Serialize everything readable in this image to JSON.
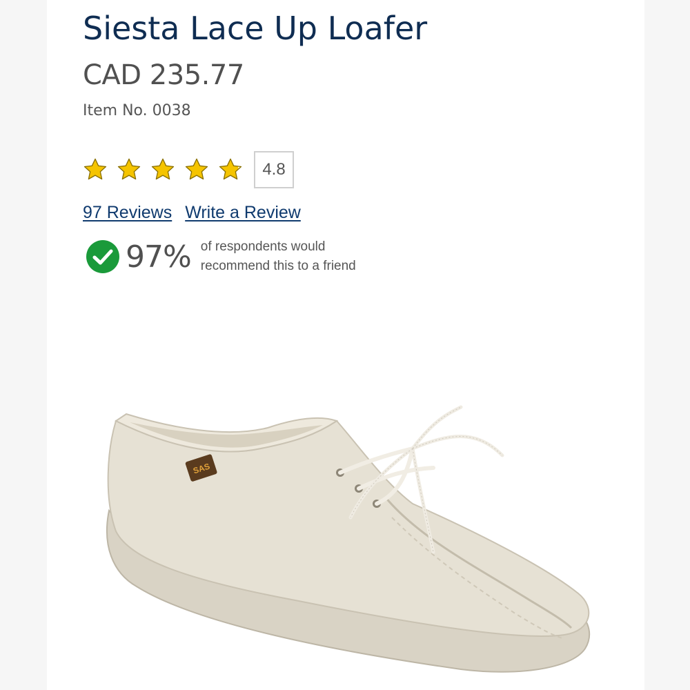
{
  "product": {
    "title": "Siesta Lace Up Loafer",
    "price": "CAD 235.77",
    "item_number": "Item No. 0038"
  },
  "rating": {
    "value": "4.8",
    "stars": 4.8,
    "star_color": "#f5c400"
  },
  "links": {
    "reviews": "97 Reviews",
    "write_review": "Write a Review",
    "link_color": "#0f3a6e"
  },
  "recommendation": {
    "percent": "97%",
    "line1": "of respondents would",
    "line2": "recommend this to a friend",
    "icon": "check-circle-icon",
    "icon_color": "#1a9a3a"
  },
  "image": {
    "subject": "product-photo-shoe",
    "logo_text": "SAS",
    "colors": {
      "leather": "#e4dfd2",
      "sole": "#d6d0c2"
    }
  },
  "colors": {
    "title": "#0f2d52",
    "text": "#555555"
  }
}
